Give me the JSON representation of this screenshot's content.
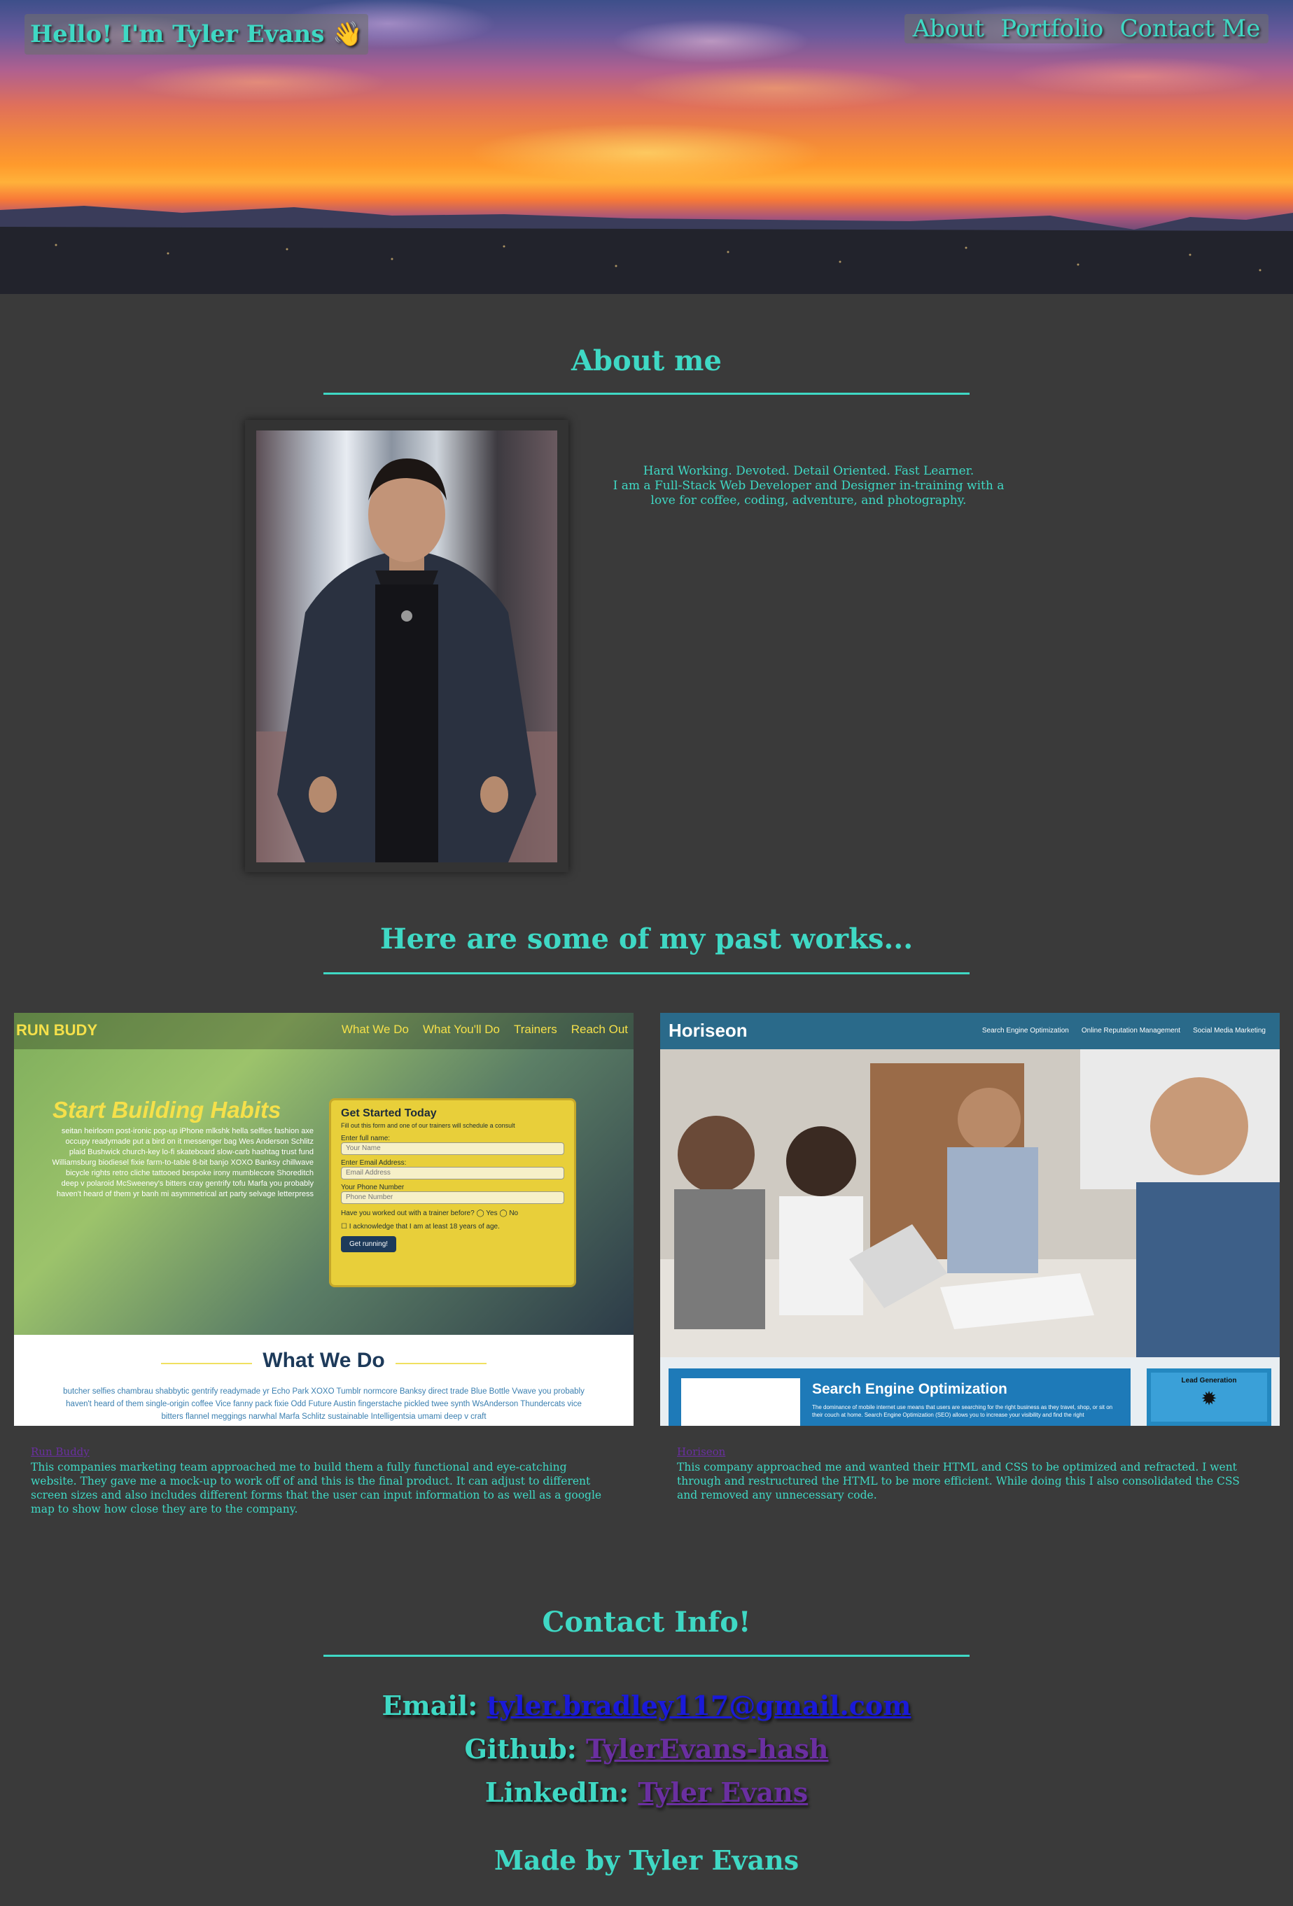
{
  "header": {
    "title": "Hello! I'm Tyler Evans 👋",
    "nav": [
      "About",
      "Portfolio",
      "Contact Me"
    ]
  },
  "about": {
    "heading": "About me",
    "tagline": "Hard Working. Devoted. Detail Oriented. Fast Learner.",
    "bio": "I am a Full-Stack Web Developer and Designer in-training with a love for coffee, coding, adventure, and photography."
  },
  "portfolio": {
    "heading": "Here are some of my past works...",
    "projects": [
      {
        "name": "Run Buddy",
        "description": "This companies marketing team approached me to build them a fully functional and eye-catching website. They gave me a mock-up to work off of and this is the final product. It can adjust to different screen sizes and also includes different forms that the user can input information to as well as a google map to show how close they are to the company.",
        "screenshot": {
          "brand": "RUN BUDY",
          "nav": [
            "What We Do",
            "What You'll Do",
            "Trainers",
            "Reach Out"
          ],
          "hero_title": "Start Building Habits",
          "hero_text": "seitan heirloom post-ironic pop-up iPhone mlkshk hella selfies fashion axe occupy readymade put a bird on it messenger bag Wes Anderson Schlitz plaid Bushwick church-key lo-fi skateboard slow-carb hashtag trust fund Williamsburg biodiesel fixie farm-to-table 8-bit banjo XOXO Banksy chillwave bicycle rights retro cliche tattooed bespoke irony mumblecore Shoreditch deep v polaroid McSweeney's bitters cray gentrify tofu Marfa you probably haven't heard of them yr banh mi asymmetrical art party selvage letterpress High Life.",
          "form_title": "Get Started Today",
          "form_sub": "Fill out this form and one of our trainers will schedule a consult",
          "fields": [
            {
              "label": "Enter full name:",
              "placeholder": "Your Name"
            },
            {
              "label": "Enter Email Address:",
              "placeholder": "Email Address"
            },
            {
              "label": "Your Phone Number",
              "placeholder": "Phone Number"
            }
          ],
          "question": "Have you worked out with a trainer before?",
          "yes": "Yes",
          "no": "No",
          "checkbox": "I acknowledge that I am at least 18 years of age.",
          "button": "Get running!",
          "section": "What We Do",
          "section_text": "butcher selfies chambrau shabbytic gentrify readymade yr Echo Park XOXO Tumblr normcore Banksy direct trade Blue Bottle Vwave you probably haven't heard of them single-origin coffee Vice fanny pack fixie Odd Future Austin fingerstache pickled twee synth WsAnderson Thundercats vice bitters flannel meggings narwhal Marfa Schlitz sustainable Intelligentsia umami deep v craft"
        }
      },
      {
        "name": "Horiseon",
        "description": "This company approached me and wanted their HTML and CSS to be optimized and refracted. I went through and restructured the HTML to be more efficient. While doing this I also consolidated the CSS and removed any unnecessary code.",
        "screenshot": {
          "brand": "Horiseon",
          "nav": [
            "Search Engine Optimization",
            "Online Reputation Management",
            "Social Media Marketing"
          ],
          "card_title": "Search Engine Optimization",
          "card_text": "The dominance of mobile internet use means that users are searching for the right business as they travel, shop, or sit on their couch at home. Search Engine Optimization (SEO) allows you to increase your visibility and find the right",
          "side_title": "Lead Generation"
        }
      }
    ]
  },
  "contact": {
    "heading": "Contact Info!",
    "email_label": "Email:",
    "email": "tyler.bradley117@gmail.com",
    "github_label": "Github:",
    "github": "TylerEvans-hash",
    "linkedin_label": "LinkedIn:",
    "linkedin": "Tyler Evans"
  },
  "footer": "Made by Tyler Evans",
  "colors": {
    "accent": "#3fd8c4",
    "background": "#3a3a3a",
    "link_visited": "#6a2fa0",
    "link": "#1a1ad8"
  }
}
